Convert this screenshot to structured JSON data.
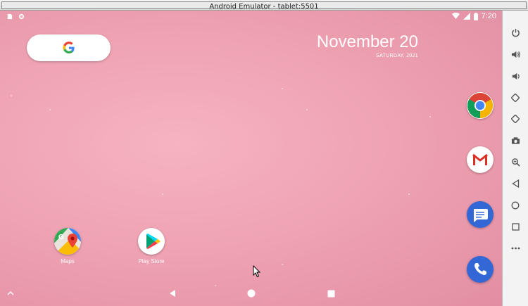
{
  "window": {
    "title": "Android Emulator - tablet:5501"
  },
  "status_bar": {
    "time": "7:20"
  },
  "google_widget": {
    "logo": "G"
  },
  "date_widget": {
    "date": "November 20",
    "weekday": "SATURDAY, 2021"
  },
  "apps": [
    {
      "label": "Maps",
      "icon": "maps-icon"
    },
    {
      "label": "Play Store",
      "icon": "play-store-icon"
    }
  ],
  "dock": [
    "chrome-icon",
    "gmail-icon",
    "messages-icon",
    "phone-icon"
  ],
  "nav_bar": [
    "back",
    "home",
    "recents"
  ],
  "emulator_toolbar": [
    "power",
    "volume-up",
    "volume-down",
    "rotate-left",
    "rotate-right",
    "screenshot",
    "zoom",
    "back",
    "home",
    "overview",
    "more"
  ],
  "colors": {
    "wallpaper": "#f3aab9",
    "toolbar_bg": "#f3f3f3"
  }
}
